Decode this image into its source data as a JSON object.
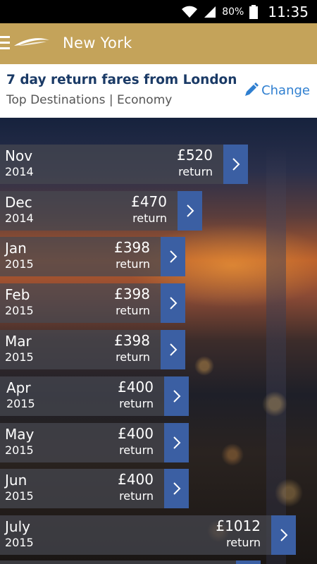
{
  "status_bar": {
    "battery_percent": "80%",
    "time": "11:35",
    "icons": [
      "wifi-icon",
      "signal-icon",
      "battery-icon"
    ]
  },
  "app_bar": {
    "title": "New York",
    "menu_icon": "hamburger-menu-icon",
    "logo": "speedmarque-logo"
  },
  "info": {
    "heading": "7 day return fares from London",
    "subheading": "Top Destinations | Economy",
    "change_label": "Change",
    "change_icon": "pencil-icon"
  },
  "fares": [
    {
      "month": "Nov",
      "year": "2014",
      "price": "£520",
      "label": "return"
    },
    {
      "month": "Dec",
      "year": "2014",
      "price": "£470",
      "label": "return"
    },
    {
      "month": "Jan",
      "year": "2015",
      "price": "£398",
      "label": "return"
    },
    {
      "month": "Feb",
      "year": "2015",
      "price": "£398",
      "label": "return"
    },
    {
      "month": "Mar",
      "year": "2015",
      "price": "£398",
      "label": "return"
    },
    {
      "month": "Apr",
      "year": "2015",
      "price": "£400",
      "label": "return"
    },
    {
      "month": "May",
      "year": "2015",
      "price": "£400",
      "label": "return"
    },
    {
      "month": "Jun",
      "year": "2015",
      "price": "£400",
      "label": "return"
    },
    {
      "month": "July",
      "year": "2015",
      "price": "£1012",
      "label": "return"
    }
  ],
  "colors": {
    "app_bar": "#c4a35a",
    "heading": "#1a3a66",
    "link": "#2f7fd0",
    "arrow_button": "#3b5fa3"
  }
}
